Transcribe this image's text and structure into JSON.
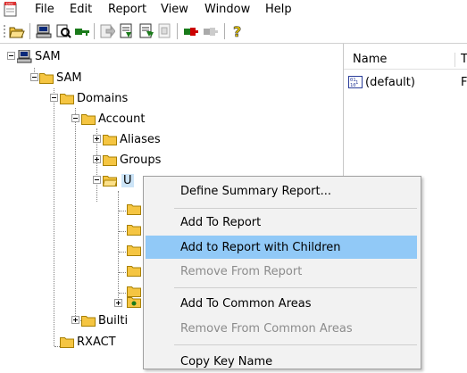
{
  "menubar": {
    "items": [
      "File",
      "Edit",
      "Report",
      "View",
      "Window",
      "Help"
    ]
  },
  "toolbar": {
    "buttons": [
      "open-icon",
      "computer-icon",
      "find-icon",
      "key-icon",
      "export-icon",
      "report-icon",
      "report-children-icon",
      "disabled-icon",
      "plug-icon",
      "plug-disabled-icon",
      "help-icon"
    ]
  },
  "tree": {
    "root": "SAM",
    "sam": "SAM",
    "domains": "Domains",
    "account": "Account",
    "aliases": "Aliases",
    "groups": "Groups",
    "users_partial": "U",
    "builtin_partial": "Builti",
    "rxact": "RXACT"
  },
  "list": {
    "col_name": "Name",
    "col_type_partial": "T",
    "rows": [
      {
        "name": "(default)",
        "type_partial": "F"
      }
    ]
  },
  "context_menu": {
    "items": [
      {
        "label": "Define Summary Report...",
        "disabled": false
      },
      {
        "label": "Add To Report",
        "disabled": false
      },
      {
        "label": "Add to Report with Children",
        "disabled": false,
        "highlighted": true
      },
      {
        "label": "Remove From Report",
        "disabled": true
      },
      {
        "label": "Add To Common Areas",
        "disabled": false
      },
      {
        "label": "Remove From Common Areas",
        "disabled": true
      },
      {
        "label": "Copy Key Name",
        "disabled": false
      }
    ]
  },
  "colors": {
    "highlight": "#91c9f7",
    "folder": "#f5c542",
    "disabled_text": "#8c8c8c"
  }
}
